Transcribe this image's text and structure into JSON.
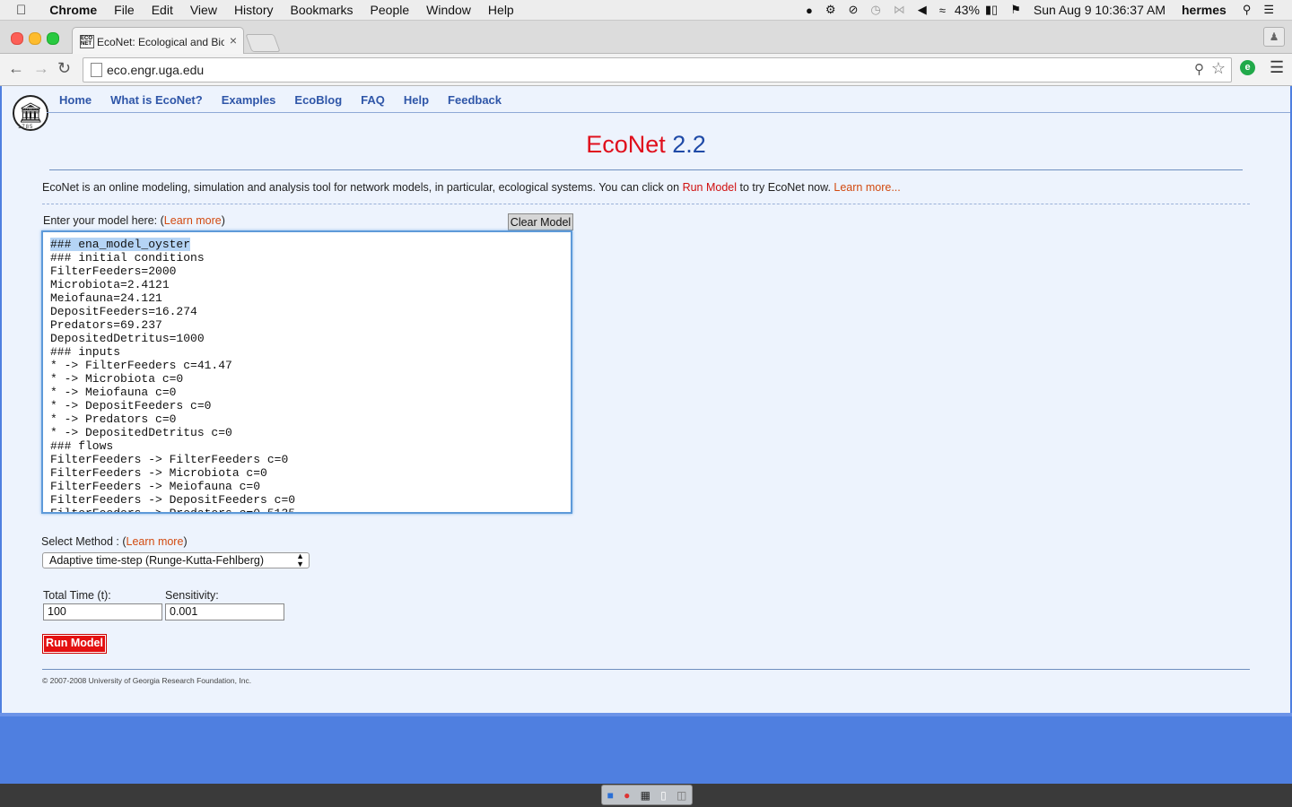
{
  "menubar": {
    "apple": "",
    "app": "Chrome",
    "items": [
      "File",
      "Edit",
      "View",
      "History",
      "Bookmarks",
      "People",
      "Window",
      "Help"
    ],
    "battery": "43%",
    "datetime": "Sun Aug 9  10:36:37 AM",
    "user": "hermes"
  },
  "browser": {
    "tab_title": "EcoNet: Ecological and Bio",
    "url": "eco.engr.uga.edu"
  },
  "site": {
    "nav": [
      "Home",
      "What is EcoNet?",
      "Examples",
      "EcoBlog",
      "FAQ",
      "Help",
      "Feedback"
    ],
    "logo_year": "1785",
    "heading_name": "EcoNet",
    "heading_version": "2.2",
    "intro_text": "EcoNet is an online modeling, simulation and analysis tool for network models, in particular, ecological systems. You can click on ",
    "intro_run": "Run Model",
    "intro_mid": " to try EcoNet now. ",
    "intro_learn": "Learn more...",
    "enter_label": "Enter your model here: (",
    "learn_more": "Learn more",
    "clear_model": "Clear Model",
    "model_first_line": "### ena_model_oyster",
    "model_text": "### initial conditions\nFilterFeeders=2000\nMicrobiota=2.4121\nMeiofauna=24.121\nDepositFeeders=16.274\nPredators=69.237\nDepositedDetritus=1000\n### inputs\n* -> FilterFeeders c=41.47\n* -> Microbiota c=0\n* -> Meiofauna c=0\n* -> DepositFeeders c=0\n* -> Predators c=0\n* -> DepositedDetritus c=0\n### flows\nFilterFeeders -> FilterFeeders c=0\nFilterFeeders -> Microbiota c=0\nFilterFeeders -> Meiofauna c=0\nFilterFeeders -> DepositFeeders c=0\nFilterFeeders -> Predators c=0.5135",
    "method_label": "Select Method : (",
    "method_selected": "Adaptive time-step (Runge-Kutta-Fehlberg)",
    "total_time_label": "Total Time (t):",
    "total_time_value": "100",
    "sensitivity_label": "Sensitivity:",
    "sensitivity_value": "0.001",
    "run_model": "Run Model",
    "copyright": "© 2007-2008 University of Georgia Research Foundation, Inc."
  }
}
